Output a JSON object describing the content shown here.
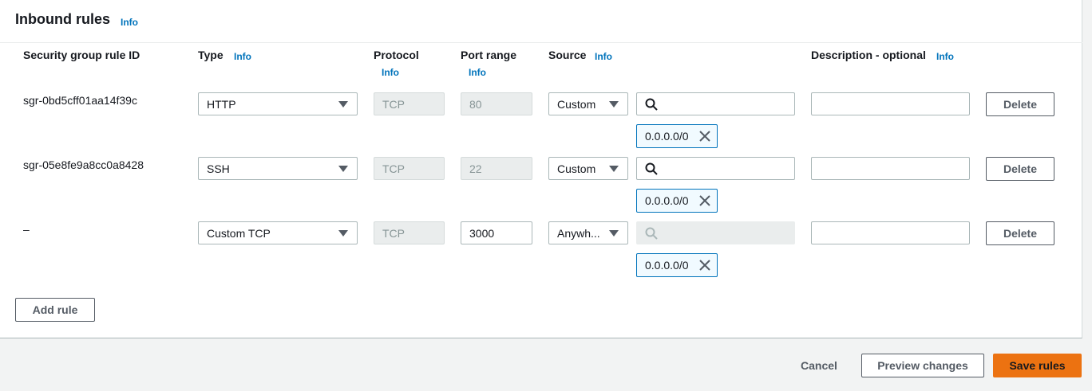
{
  "panel": {
    "title": "Inbound rules",
    "info_label": "Info"
  },
  "columns": {
    "rule_id": "Security group rule ID",
    "type": "Type",
    "protocol": "Protocol",
    "port_range": "Port range",
    "source": "Source",
    "description": "Description - optional",
    "info": "Info"
  },
  "rules": [
    {
      "rule_id": "sgr-0bd5cff01aa14f39c",
      "type": "HTTP",
      "protocol": "TCP",
      "port_range": "80",
      "source": "Custom",
      "search_value": "",
      "cidr": "0.0.0.0/0",
      "description": "",
      "delete_label": "Delete"
    },
    {
      "rule_id": "sgr-05e8fe9a8cc0a8428",
      "type": "SSH",
      "protocol": "TCP",
      "port_range": "22",
      "source": "Custom",
      "search_value": "",
      "cidr": "0.0.0.0/0",
      "description": "",
      "delete_label": "Delete"
    },
    {
      "rule_id": "–",
      "type": "Custom TCP",
      "protocol": "TCP",
      "port_range": "3000",
      "source": "Anywh...",
      "search_value": "",
      "cidr": "0.0.0.0/0",
      "description": "",
      "delete_label": "Delete"
    }
  ],
  "add_rule_label": "Add rule",
  "footer": {
    "cancel_label": "Cancel",
    "preview_label": "Preview changes",
    "save_label": "Save rules"
  },
  "colors": {
    "link": "#0073bb",
    "primary": "#ec7211",
    "token_border": "#0073bb"
  }
}
